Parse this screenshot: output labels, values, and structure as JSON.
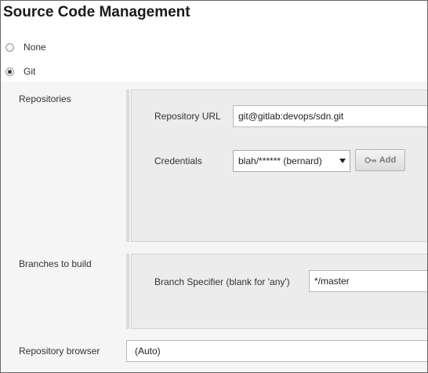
{
  "section": {
    "title": "Source Code Management"
  },
  "scm_options": [
    {
      "label": "None",
      "checked": false
    },
    {
      "label": "Git",
      "checked": true
    }
  ],
  "repositories": {
    "label": "Repositories",
    "url_label": "Repository URL",
    "url_value": "git@gitlab:devops/sdn.git",
    "credentials_label": "Credentials",
    "credentials_value": "blah/****** (bernard)",
    "add_button_label": "Add"
  },
  "branches": {
    "label": "Branches to build",
    "specifier_label": "Branch Specifier (blank for 'any')",
    "specifier_value": "*/master"
  },
  "repository_browser": {
    "label": "Repository browser",
    "value": "(Auto)"
  },
  "icons": {
    "add": "key-icon",
    "dropdown": "dropdown-arrow-icon"
  }
}
